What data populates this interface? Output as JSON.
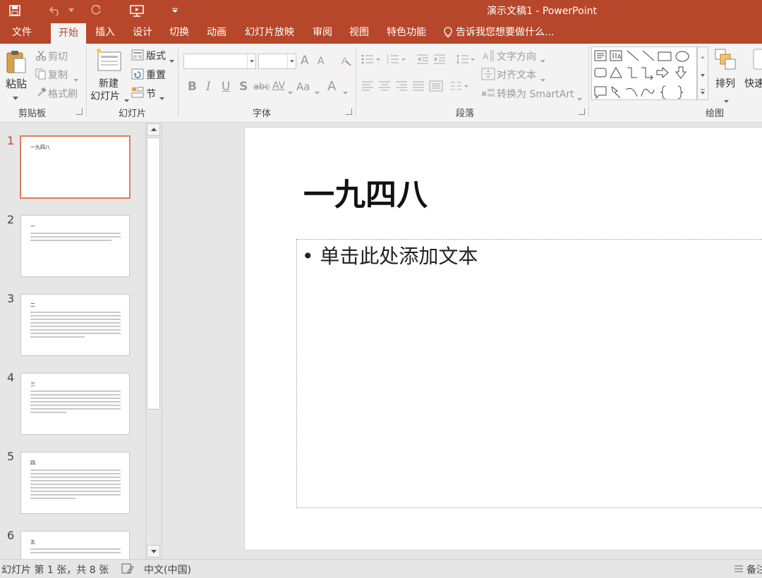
{
  "app": {
    "window_title": "演示文稿1 - PowerPoint"
  },
  "menu": {
    "tabs": [
      {
        "label": "文件"
      },
      {
        "label": "开始"
      },
      {
        "label": "插入"
      },
      {
        "label": "设计"
      },
      {
        "label": "切换"
      },
      {
        "label": "动画"
      },
      {
        "label": "幻灯片放映"
      },
      {
        "label": "审阅"
      },
      {
        "label": "视图"
      },
      {
        "label": "特色功能"
      }
    ],
    "active_tab": "开始",
    "tell_me": "告诉我您想要做什么..."
  },
  "ribbon": {
    "clipboard": {
      "paste": "粘贴",
      "cut": "剪切",
      "copy": "复制",
      "format_painter": "格式刷",
      "label": "剪贴板"
    },
    "slides": {
      "new_slide_line1": "新建",
      "new_slide_line2": "幻灯片",
      "layout": "版式",
      "reset": "重置",
      "section": "节",
      "label": "幻灯片"
    },
    "font": {
      "label": "字体",
      "grow": "A",
      "shrink": "A",
      "bold": "B",
      "italic": "I",
      "underline": "U",
      "shadow": "S",
      "strike": "abc",
      "spacing": "AV",
      "case": "Aa",
      "color": "A"
    },
    "paragraph": {
      "label": "段落",
      "text_direction": "文字方向",
      "align_text": "对齐文本",
      "smartart": "转换为 SmartArt"
    },
    "drawing": {
      "arrange": "排列",
      "quick_styles": "快速",
      "label": "绘图"
    }
  },
  "slides_pane": {
    "thumbnails": [
      {
        "number": "1",
        "title": "一九四八"
      },
      {
        "number": "2",
        "title": "一"
      },
      {
        "number": "3",
        "title": "二"
      },
      {
        "number": "4",
        "title": "三"
      },
      {
        "number": "5",
        "title": "四"
      },
      {
        "number": "6",
        "title": "五"
      }
    ]
  },
  "slide": {
    "title": "一九四八",
    "placeholder": "• 单击此处添加文本"
  },
  "status": {
    "slide_info": "幻灯片 第 1 张，共 8 张",
    "language": "中文(中国)",
    "notes": "备注"
  },
  "colors": {
    "accent": "#b7472a",
    "ribbon_bg": "#f3f3f3",
    "active_thumb_border": "#e27b5a"
  }
}
